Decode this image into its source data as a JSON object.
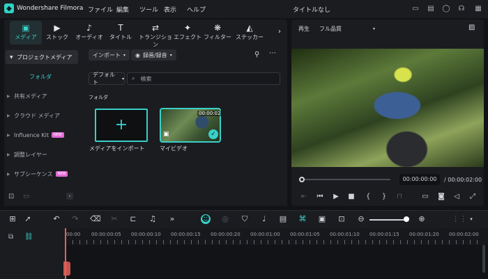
{
  "app": {
    "name": "Wondershare Filmora",
    "project_title": "タイトルなし",
    "menu": [
      "ファイル",
      "編集",
      "ツール",
      "表示",
      "ヘルプ"
    ]
  },
  "tool_tabs": [
    {
      "label": "メディア",
      "icon": "media-icon",
      "glyph": "▣"
    },
    {
      "label": "ストック",
      "icon": "stock-icon",
      "glyph": "▶"
    },
    {
      "label": "オーディオ",
      "icon": "music-note-icon",
      "glyph": "♪"
    },
    {
      "label": "タイトル",
      "icon": "text-icon",
      "glyph": "T"
    },
    {
      "label": "トランジション",
      "icon": "transition-icon",
      "glyph": "⇄"
    },
    {
      "label": "エフェクト",
      "icon": "sparkle-icon",
      "glyph": "✦"
    },
    {
      "label": "フィルター",
      "icon": "filter-icon",
      "glyph": "❋"
    },
    {
      "label": "ステッカー",
      "icon": "sticker-icon",
      "glyph": "◭"
    }
  ],
  "sidebar": {
    "project_media": "プロジェクトメディア",
    "folder": "フォルダ",
    "items": [
      {
        "label": "共有メディア",
        "badge": ""
      },
      {
        "label": "クラウド メディア",
        "badge": ""
      },
      {
        "label": "Influence Kit",
        "badge": "NEW"
      },
      {
        "label": "調整レイヤー",
        "badge": ""
      },
      {
        "label": "サブシーケンス",
        "badge": "NEW"
      }
    ]
  },
  "media": {
    "import_button": "インポート",
    "record_button": "録画/録音",
    "sort_default": "デフォルト",
    "search_placeholder": "検索",
    "folder_section": "フォルダ",
    "import_tile_label": "メディアをインポート",
    "clip_label": "マイビデオ",
    "clip_duration": "00:00:02"
  },
  "preview": {
    "play_label": "再生",
    "quality": "フル品質",
    "current_time": "00:00:00:00",
    "total_time": "/ 00:00:02:00"
  },
  "timeline": {
    "ruler_labels": [
      "00:00",
      "00:00:00:05",
      "00:00:00:10",
      "00:00:00:15",
      "00:00:00:20",
      "00:00:01:00",
      "00:00:01:05",
      "00:00:01:10",
      "00:00:01:15",
      "00:00:01:20",
      "00:00:02:00"
    ]
  },
  "colors": {
    "accent": "#39d0c8",
    "playhead": "#e8605a",
    "new_badge": "#e06cd5"
  }
}
